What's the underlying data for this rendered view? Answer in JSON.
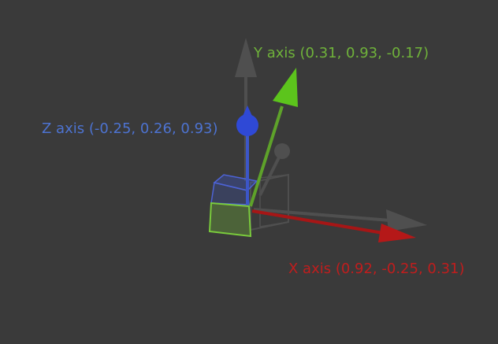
{
  "axes": {
    "y": {
      "label": "Y axis (0.31, 0.93, -0.17)",
      "color": "#6fb23a"
    },
    "z": {
      "label": "Z axis (-0.25, 0.26, 0.93)",
      "color": "#4d73d1"
    },
    "x": {
      "label": "X axis (0.92, -0.25, 0.31)",
      "color": "#c01d1d"
    }
  },
  "colors": {
    "background": "#3a3a3a",
    "reference_frame": "#505050",
    "cube_green": "#7acb3c",
    "cube_blue": "#3c56c8"
  }
}
